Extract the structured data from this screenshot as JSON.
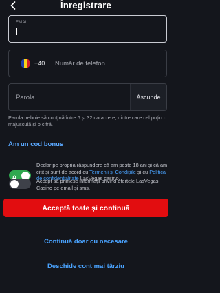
{
  "header": {
    "title": "Înregistrare",
    "back_icon": "chevron-left-icon"
  },
  "email": {
    "label": "EMAIL",
    "value": ""
  },
  "phone": {
    "flag_colors": [
      "#1f3ea6",
      "#f5d21b",
      "#d51f2a"
    ],
    "prefix": "+40",
    "placeholder": "Număr de telefon"
  },
  "password": {
    "label": "Parola",
    "show_label": "Ascunde"
  },
  "password_hint": "Parola trebuie să conțină între 6 și 32 caractere, dintre care cel puțin o majusculă și o cifră.",
  "bonus_link": "Am un cod bonus",
  "consent_terms": {
    "text_1": "Declar pe propria răspundere că am peste 18 ani și că am citit și sunt de acord cu ",
    "terms_link": "Termenii și Condițiile",
    "text_2": " și cu ",
    "privacy_link": "Politica de confidențialitate",
    "text_3": " LasVegas casino.",
    "enabled": true
  },
  "consent_marketing": {
    "text": "Accept să primesc informații privind ofertele LasVegas Casino pe email și sms.",
    "enabled": false
  },
  "buttons": {
    "accept_all": "Acceptă toate și continuă",
    "necessary_only": "Continuă doar cu necesare",
    "later": "Deschide cont mai târziu"
  },
  "colors": {
    "accent": "#e20d10",
    "link": "#4aa3ff",
    "toggle_on": "#2fa84f",
    "background": "#14161c"
  }
}
